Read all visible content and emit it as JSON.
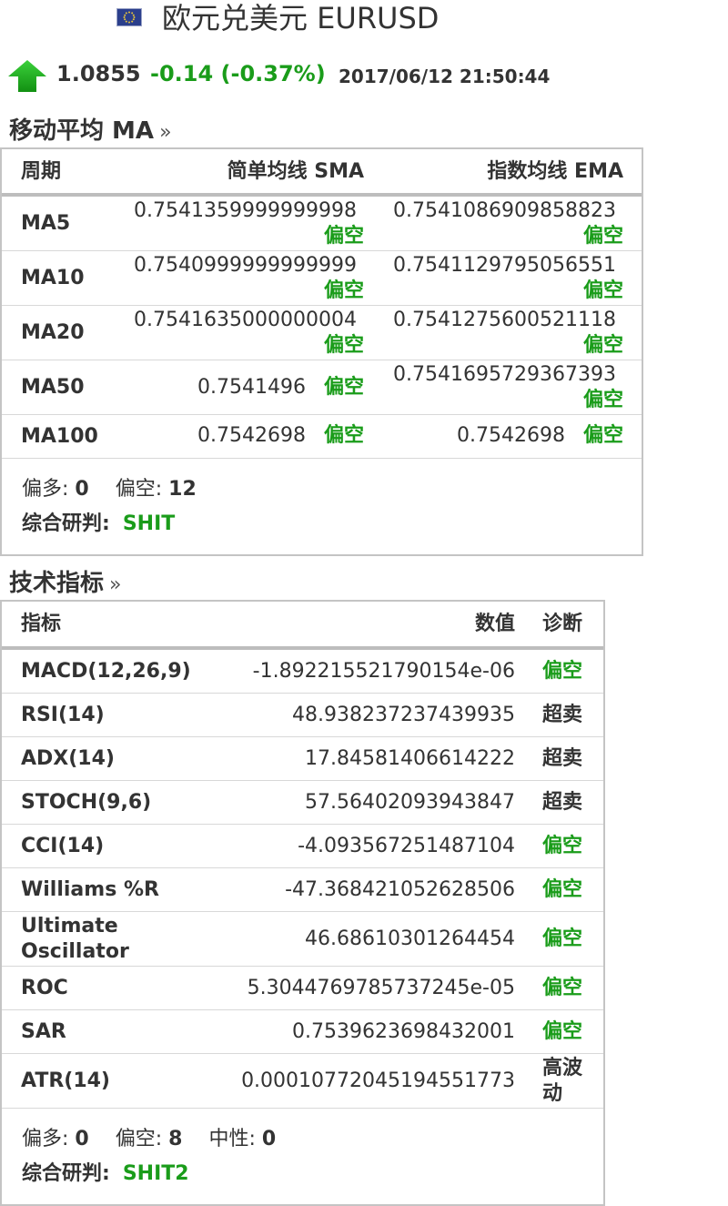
{
  "header": {
    "title": "欧元兑美元 EURUSD",
    "flag_icon": "eu-flag-icon"
  },
  "quote": {
    "price": "1.0855",
    "change": "-0.14 (-0.37%)",
    "timestamp": "2017/06/12 21:50:44",
    "direction_icon": "up-arrow-icon",
    "colors": {
      "up": "#1a9c1a",
      "change": "#1a9c1a"
    }
  },
  "ma": {
    "title": "移动平均 MA",
    "more": "»",
    "columns": {
      "period": "周期",
      "sma": "简单均线 SMA",
      "ema": "指数均线 EMA"
    },
    "rows": [
      {
        "period": "MA5",
        "sma": "0.7541359999999998",
        "sma_sig": "偏空",
        "ema": "0.7541086909858823",
        "ema_sig": "偏空"
      },
      {
        "period": "MA10",
        "sma": "0.7540999999999999",
        "sma_sig": "偏空",
        "ema": "0.7541129795056551",
        "ema_sig": "偏空"
      },
      {
        "period": "MA20",
        "sma": "0.7541635000000004",
        "sma_sig": "偏空",
        "ema": "0.7541275600521118",
        "ema_sig": "偏空"
      },
      {
        "period": "MA50",
        "sma": "0.7541496",
        "sma_sig": "偏空",
        "ema": "0.7541695729367393",
        "ema_sig": "偏空"
      },
      {
        "period": "MA100",
        "sma": "0.7542698",
        "sma_sig": "偏空",
        "ema": "0.7542698",
        "ema_sig": "偏空"
      }
    ],
    "summary": {
      "bull_label": "偏多:",
      "bull": "0",
      "bear_label": "偏空:",
      "bear": "12",
      "verdict_label": "综合研判:",
      "verdict": "SHIT"
    }
  },
  "ti": {
    "title": "技术指标",
    "more": "»",
    "columns": {
      "indicator": "指标",
      "value": "数值",
      "diagnosis": "诊断"
    },
    "rows": [
      {
        "name": "MACD(12,26,9)",
        "value": "-1.892215521790154e-06",
        "diag": "偏空",
        "green": true
      },
      {
        "name": "RSI(14)",
        "value": "48.938237237439935",
        "diag": "超卖",
        "green": false
      },
      {
        "name": "ADX(14)",
        "value": "17.84581406614222",
        "diag": "超卖",
        "green": false
      },
      {
        "name": "STOCH(9,6)",
        "value": "57.56402093943847",
        "diag": "超卖",
        "green": false
      },
      {
        "name": "CCI(14)",
        "value": "-4.093567251487104",
        "diag": "偏空",
        "green": true
      },
      {
        "name": "Williams %R",
        "value": "-47.368421052628506",
        "diag": "偏空",
        "green": true
      },
      {
        "name": "Ultimate Oscillator",
        "value": "46.68610301264454",
        "diag": "偏空",
        "green": true
      },
      {
        "name": "ROC",
        "value": "5.3044769785737245e-05",
        "diag": "偏空",
        "green": true
      },
      {
        "name": "SAR",
        "value": "0.7539623698432001",
        "diag": "偏空",
        "green": true
      },
      {
        "name": "ATR(14)",
        "value": "0.00010772045194551773",
        "diag": "高波动",
        "green": false
      }
    ],
    "summary": {
      "bull_label": "偏多:",
      "bull": "0",
      "bear_label": "偏空:",
      "bear": "8",
      "neutral_label": "中性:",
      "neutral": "0",
      "verdict_label": "综合研判:",
      "verdict": "SHIT2"
    }
  }
}
